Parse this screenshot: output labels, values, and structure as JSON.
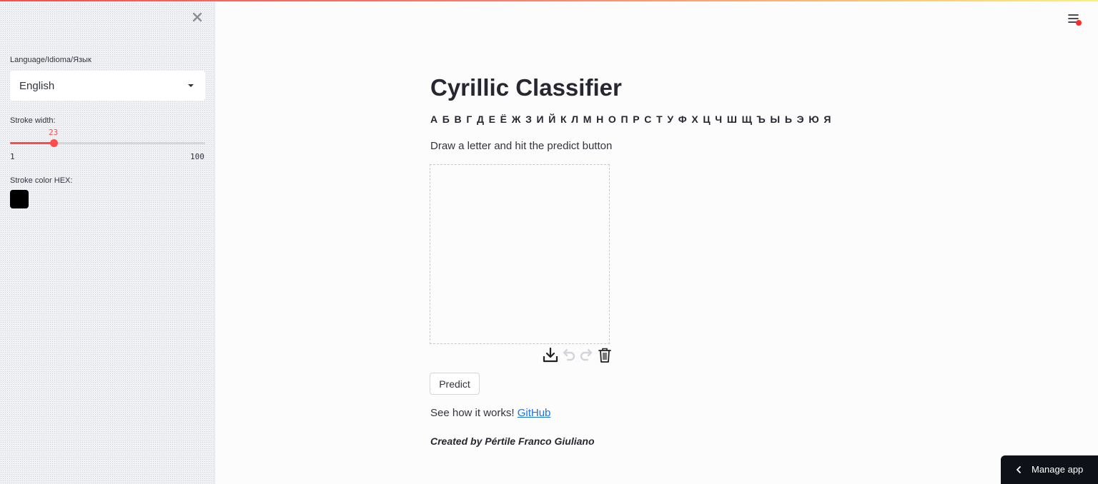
{
  "sidebar": {
    "language_label": "Language/Idioma/Язык",
    "language_value": "English",
    "stroke_width_label": "Stroke width:",
    "stroke_width_value": "23",
    "stroke_width_min": "1",
    "stroke_width_max": "100",
    "stroke_color_label": "Stroke color HEX:",
    "stroke_color_value": "#000000",
    "close_icon": "close-icon"
  },
  "main": {
    "title": "Cyrillic Classifier",
    "alphabet": "А Б В Г Д Е Ё Ж З И Й К Л М Н О П Р С Т У Ф Х Ц Ч Ш Щ Ъ Ы Ь Э Ю Я",
    "instructions": "Draw a letter and hit the predict button",
    "predict_label": "Predict",
    "see_how_text": "See how it works!",
    "github_link": "GitHub",
    "credit": "Created by Pértile Franco Giuliano",
    "canvas_tools": [
      "download-icon",
      "undo-icon",
      "redo-icon",
      "trash-icon"
    ]
  },
  "header": {
    "menu_icon": "hamburger-menu-icon"
  },
  "footer": {
    "manage_app_label": "Manage app"
  },
  "colors": {
    "accent": "#ff4b4b",
    "link": "#1a73e8",
    "manage_bg": "#0e1117"
  }
}
